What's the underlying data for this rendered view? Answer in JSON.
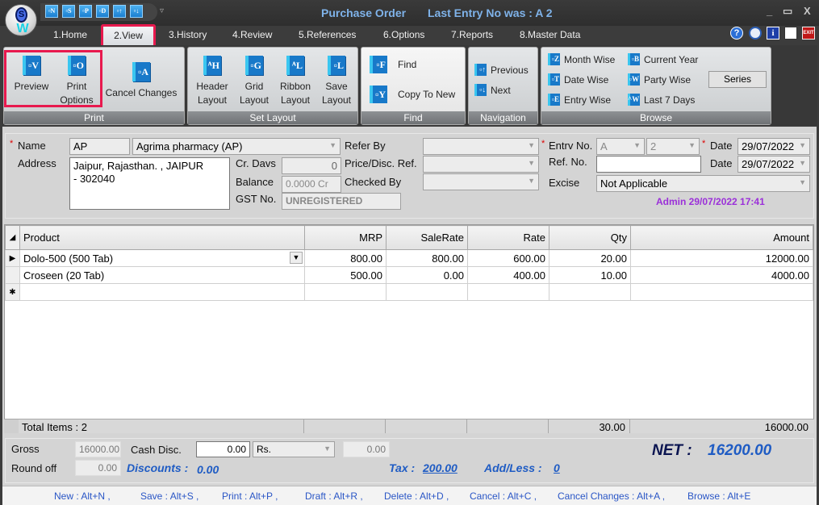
{
  "window": {
    "title": "Purchase Order",
    "last_entry": "Last Entry No was : A 2",
    "controls": {
      "minimize": "_",
      "maximize": "▭",
      "close": "X"
    }
  },
  "quick_access": [
    {
      "icon": "new-icon",
      "glyph": "▫N"
    },
    {
      "icon": "save-icon",
      "glyph": "▫S"
    },
    {
      "icon": "print-icon",
      "glyph": "▫P"
    },
    {
      "icon": "delete-icon",
      "glyph": "▫D"
    },
    {
      "icon": "previous-icon",
      "glyph": "▫↑"
    },
    {
      "icon": "next-icon",
      "glyph": "▫↓"
    }
  ],
  "tabs": [
    {
      "label": "1.Home"
    },
    {
      "label": "2.View",
      "active": true
    },
    {
      "label": "3.History"
    },
    {
      "label": "4.Review"
    },
    {
      "label": "5.References"
    },
    {
      "label": "6.Options"
    },
    {
      "label": "7.Reports"
    },
    {
      "label": "8.Master Data"
    }
  ],
  "top_icons": [
    "help-icon",
    "support-icon",
    "info-icon",
    "document-icon",
    "exit-icon"
  ],
  "ribbon": {
    "print": {
      "caption": "Print",
      "buttons": [
        {
          "label": "Preview",
          "glyph": "▫V"
        },
        {
          "label": "Print Options",
          "glyph": "▫O"
        },
        {
          "label": "Cancel Changes",
          "glyph": "▫A"
        }
      ]
    },
    "set_layout": {
      "caption": "Set Layout",
      "buttons": [
        {
          "label": "Header Layout",
          "glyph": "ᴬH"
        },
        {
          "label": "Grid Layout",
          "glyph": "▫G"
        },
        {
          "label": "Ribbon Layout",
          "glyph": "ᴬL"
        },
        {
          "label": "Save Layout",
          "glyph": "▫L"
        }
      ]
    },
    "find": {
      "caption": "Find",
      "buttons": [
        {
          "label": "Find",
          "glyph": "▫F"
        },
        {
          "label": "Copy To New",
          "glyph": "▫Y"
        }
      ]
    },
    "navigation": {
      "caption": "Navigation",
      "buttons": [
        {
          "label": "Previous",
          "glyph": "▫↑"
        },
        {
          "label": "Next",
          "glyph": "▫↓"
        }
      ]
    },
    "browse": {
      "caption": "Browse",
      "buttons": [
        {
          "label": "Month Wise",
          "glyph": "▫Z"
        },
        {
          "label": "Date Wise",
          "glyph": "▫T"
        },
        {
          "label": "Entry Wise",
          "glyph": "▫E"
        },
        {
          "label": "Current Year",
          "glyph": "▫B"
        },
        {
          "label": "Party Wise",
          "glyph": "▫W"
        },
        {
          "label": "Last 7 Days",
          "glyph": "^W"
        }
      ],
      "series_label": "Series"
    }
  },
  "form": {
    "name_label": "Name",
    "name_code": "AP",
    "name_value": "Agrima pharmacy (AP)",
    "address_label": "Address",
    "address_line1": "Jaipur, Rajasthan.  , JAIPUR",
    "address_line2": "- 302040",
    "cr_days_label": "Cr. Davs",
    "cr_days_value": "0",
    "balance_label": "Balance",
    "balance_value": "0.0000 Cr",
    "gst_label": "GST No.",
    "gst_value": "UNREGISTERED",
    "refer_by_label": "Refer By",
    "refer_by_value": "",
    "price_disc_label": "Price/Disc. Ref.",
    "price_disc_value": "",
    "checked_by_label": "Checked By",
    "checked_by_value": "",
    "entry_no_label": "Entrv No.",
    "entry_series": "A",
    "entry_number": "2",
    "date_label": "Date",
    "date_value": "29/07/2022",
    "ref_no_label": "Ref. No.",
    "ref_no_value": "",
    "ref_date_label": "Date",
    "ref_date_value": "29/07/2022",
    "excise_label": "Excise",
    "excise_value": "Not Applicable",
    "audit": "Admin 29/07/2022 17:41"
  },
  "grid": {
    "columns": [
      "Product",
      "MRP",
      "SaleRate",
      "Rate",
      "Qty",
      "Amount"
    ],
    "rows": [
      {
        "product": "Dolo-500 (500 Tab)",
        "mrp": "800.00",
        "sale_rate": "800.00",
        "rate": "600.00",
        "qty": "20.00",
        "amount": "12000.00"
      },
      {
        "product": "Croseen (20 Tab)",
        "mrp": "500.00",
        "sale_rate": "0.00",
        "rate": "400.00",
        "qty": "10.00",
        "amount": "4000.00"
      }
    ],
    "total_items": "Total Items : 2",
    "total_qty": "30.00",
    "total_amount": "16000.00"
  },
  "summary": {
    "gross_label": "Gross",
    "gross_value": "16000.00",
    "cash_disc_label": "Cash Disc.",
    "cash_disc_value": "0.00",
    "cash_disc_unit": "Rs.",
    "cash_disc_amount": "0.00",
    "round_off_label": "Round off",
    "round_off_value": "0.00",
    "discounts_label": "Discounts :",
    "discounts_value": "0.00",
    "tax_label": "Tax :",
    "tax_value": "200.00",
    "addless_label": "Add/Less :",
    "addless_value": "0",
    "net_label": "NET :",
    "net_value": "16200.00"
  },
  "shortcuts": [
    "New : Alt+N ,",
    "Save : Alt+S ,",
    "Print : Alt+P ,",
    "Draft : Alt+R ,",
    "Delete : Alt+D ,",
    "Cancel : Alt+C ,",
    "Cancel Changes : Alt+A ,",
    "Browse : Alt+E"
  ],
  "colors": {
    "highlight": "#e8194e",
    "title_text": "#7fb3ea",
    "link_blue": "#1f5cc4",
    "audit_purple": "#9b30d9",
    "net_label": "#0a1450"
  }
}
